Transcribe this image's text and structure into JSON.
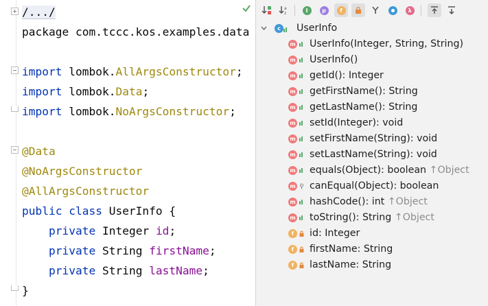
{
  "editor": {
    "lines": [
      {
        "folded": "/.../"
      },
      {
        "text": "package com.tccc.kos.examples.data"
      },
      {
        "text": ""
      },
      {
        "kw": "import",
        "rest": " lombok.",
        "ann": "AllArgsConstructor",
        "end": ";"
      },
      {
        "kw": "import",
        "rest": " lombok.",
        "ann": "Data",
        "end": ";"
      },
      {
        "kw": "import",
        "rest": " lombok.",
        "ann": "NoArgsConstructor",
        "end": ";"
      },
      {
        "text": ""
      },
      {
        "ann": "@Data"
      },
      {
        "ann": "@NoArgsConstructor"
      },
      {
        "ann": "@AllArgsConstructor"
      },
      {
        "kw": "public class",
        "rest": " UserInfo {"
      },
      {
        "indent": "    ",
        "kw": "private",
        "rest": " Integer ",
        "fld": "id",
        "end": ";"
      },
      {
        "indent": "    ",
        "kw": "private",
        "rest": " String ",
        "fld": "firstName",
        "end": ";"
      },
      {
        "indent": "    ",
        "kw": "private",
        "rest": " String ",
        "fld": "lastName",
        "end": ";"
      },
      {
        "text": "}"
      }
    ]
  },
  "structure": {
    "toolbar_icons": [
      "sort-by-type-icon",
      "sort-alphabetically-icon",
      "show-inherited-icon",
      "show-properties-icon",
      "show-fields-icon",
      "show-non-public-icon",
      "show-lambdas-icon",
      "show-anonymous-icon",
      "show-lambda-icon",
      "autoscroll-to-source-icon",
      "autoscroll-from-source-icon"
    ],
    "root": "UserInfo",
    "items": [
      {
        "kind": "m",
        "label": "UserInfo(Integer, String, String)",
        "inherited": ""
      },
      {
        "kind": "m",
        "label": "UserInfo()",
        "inherited": ""
      },
      {
        "kind": "m",
        "label": "getId(): Integer",
        "inherited": ""
      },
      {
        "kind": "m",
        "label": "getFirstName(): String",
        "inherited": ""
      },
      {
        "kind": "m",
        "label": "getLastName(): String",
        "inherited": ""
      },
      {
        "kind": "m",
        "label": "setId(Integer): void",
        "inherited": ""
      },
      {
        "kind": "m",
        "label": "setFirstName(String): void",
        "inherited": ""
      },
      {
        "kind": "m",
        "label": "setLastName(String): void",
        "inherited": ""
      },
      {
        "kind": "m",
        "label": "equals(Object): boolean",
        "inherited": "Object"
      },
      {
        "kind": "m",
        "label": "canEqual(Object): boolean",
        "inherited": "",
        "protected": true
      },
      {
        "kind": "m",
        "label": "hashCode(): int",
        "inherited": "Object"
      },
      {
        "kind": "m",
        "label": "toString(): String",
        "inherited": "Object"
      },
      {
        "kind": "f",
        "label": "id: Integer",
        "inherited": ""
      },
      {
        "kind": "f",
        "label": "firstName: String",
        "inherited": ""
      },
      {
        "kind": "f",
        "label": "lastName: String",
        "inherited": ""
      }
    ]
  }
}
